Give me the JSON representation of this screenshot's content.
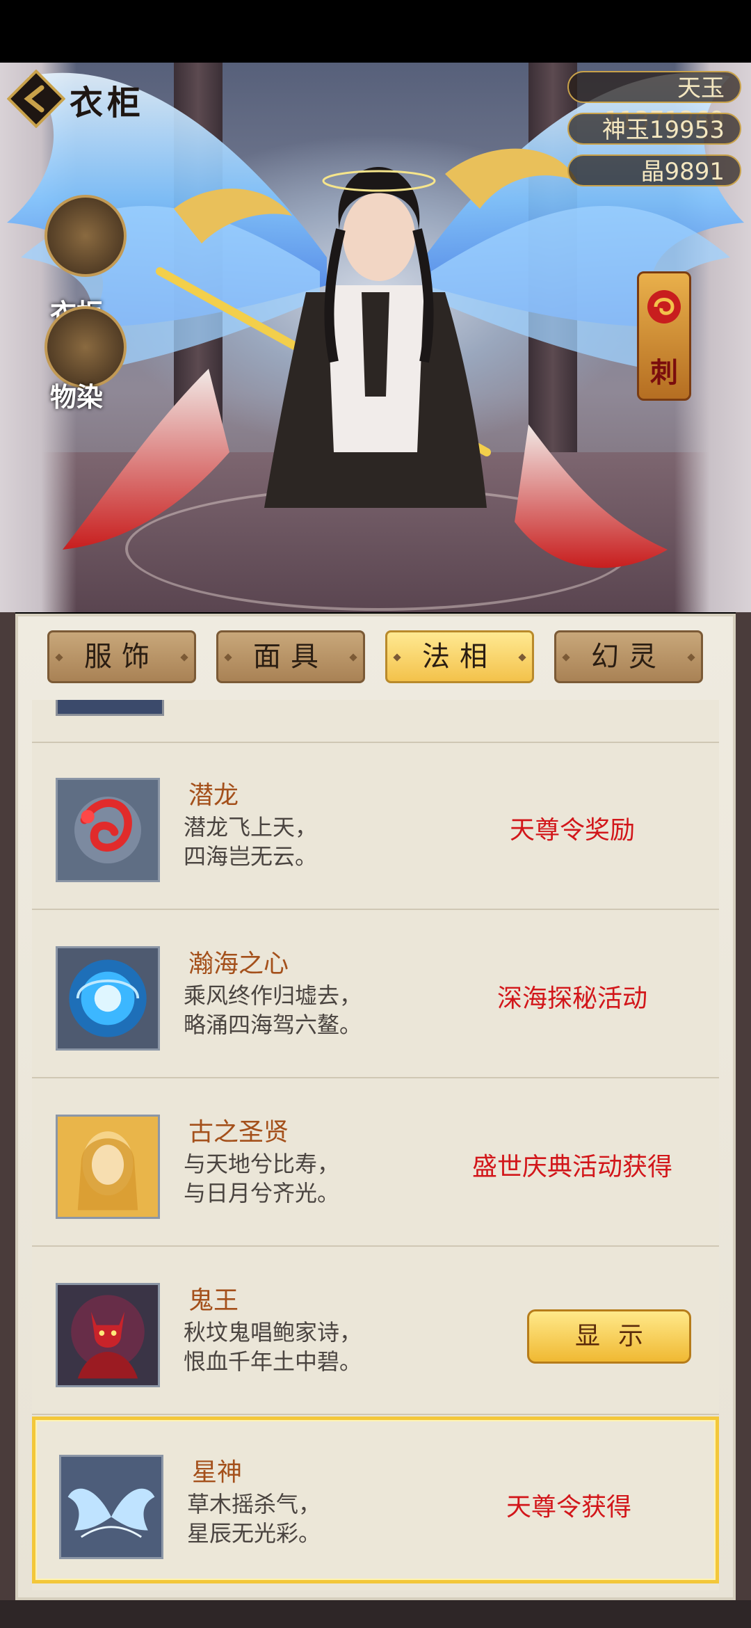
{
  "header": {
    "title": "衣柜",
    "currencies": [
      "天玉11371269",
      "神玉19953",
      "晶9891"
    ]
  },
  "side_buttons": [
    "衣柜",
    "物染"
  ],
  "right_seal": "刺",
  "tabs": [
    {
      "label": "服饰",
      "active": false
    },
    {
      "label": "面具",
      "active": false
    },
    {
      "label": "法相",
      "active": true
    },
    {
      "label": "幻灵",
      "active": false
    }
  ],
  "items": [
    {
      "name": "潜龙",
      "desc": [
        "潜龙飞上天，",
        "四海岂无云。"
      ],
      "source": "天尊令奖励",
      "icon": "red-dragon-icon"
    },
    {
      "name": "瀚海之心",
      "desc": [
        "乘风终作归墟去，",
        "略涌四海驾六鳌。"
      ],
      "source": "深海探秘活动",
      "icon": "blue-vortex-icon"
    },
    {
      "name": "古之圣贤",
      "desc": [
        "与天地兮比寿，",
        "与日月兮齐光。"
      ],
      "source": "盛世庆典活动获得",
      "icon": "golden-sage-icon"
    },
    {
      "name": "鬼王",
      "desc": [
        "秋坟鬼唱鲍家诗，",
        "恨血千年土中碧。"
      ],
      "button": "显示",
      "icon": "ghost-king-icon"
    },
    {
      "name": "星神",
      "desc": [
        "草木摇杀气，",
        "星辰无光彩。"
      ],
      "source": "天尊令获得",
      "icon": "star-wings-icon",
      "selected": true
    }
  ],
  "colors": {
    "accent_gold": "#f3c24b",
    "source_red": "#d2161a",
    "name_brown": "#a4501b"
  }
}
